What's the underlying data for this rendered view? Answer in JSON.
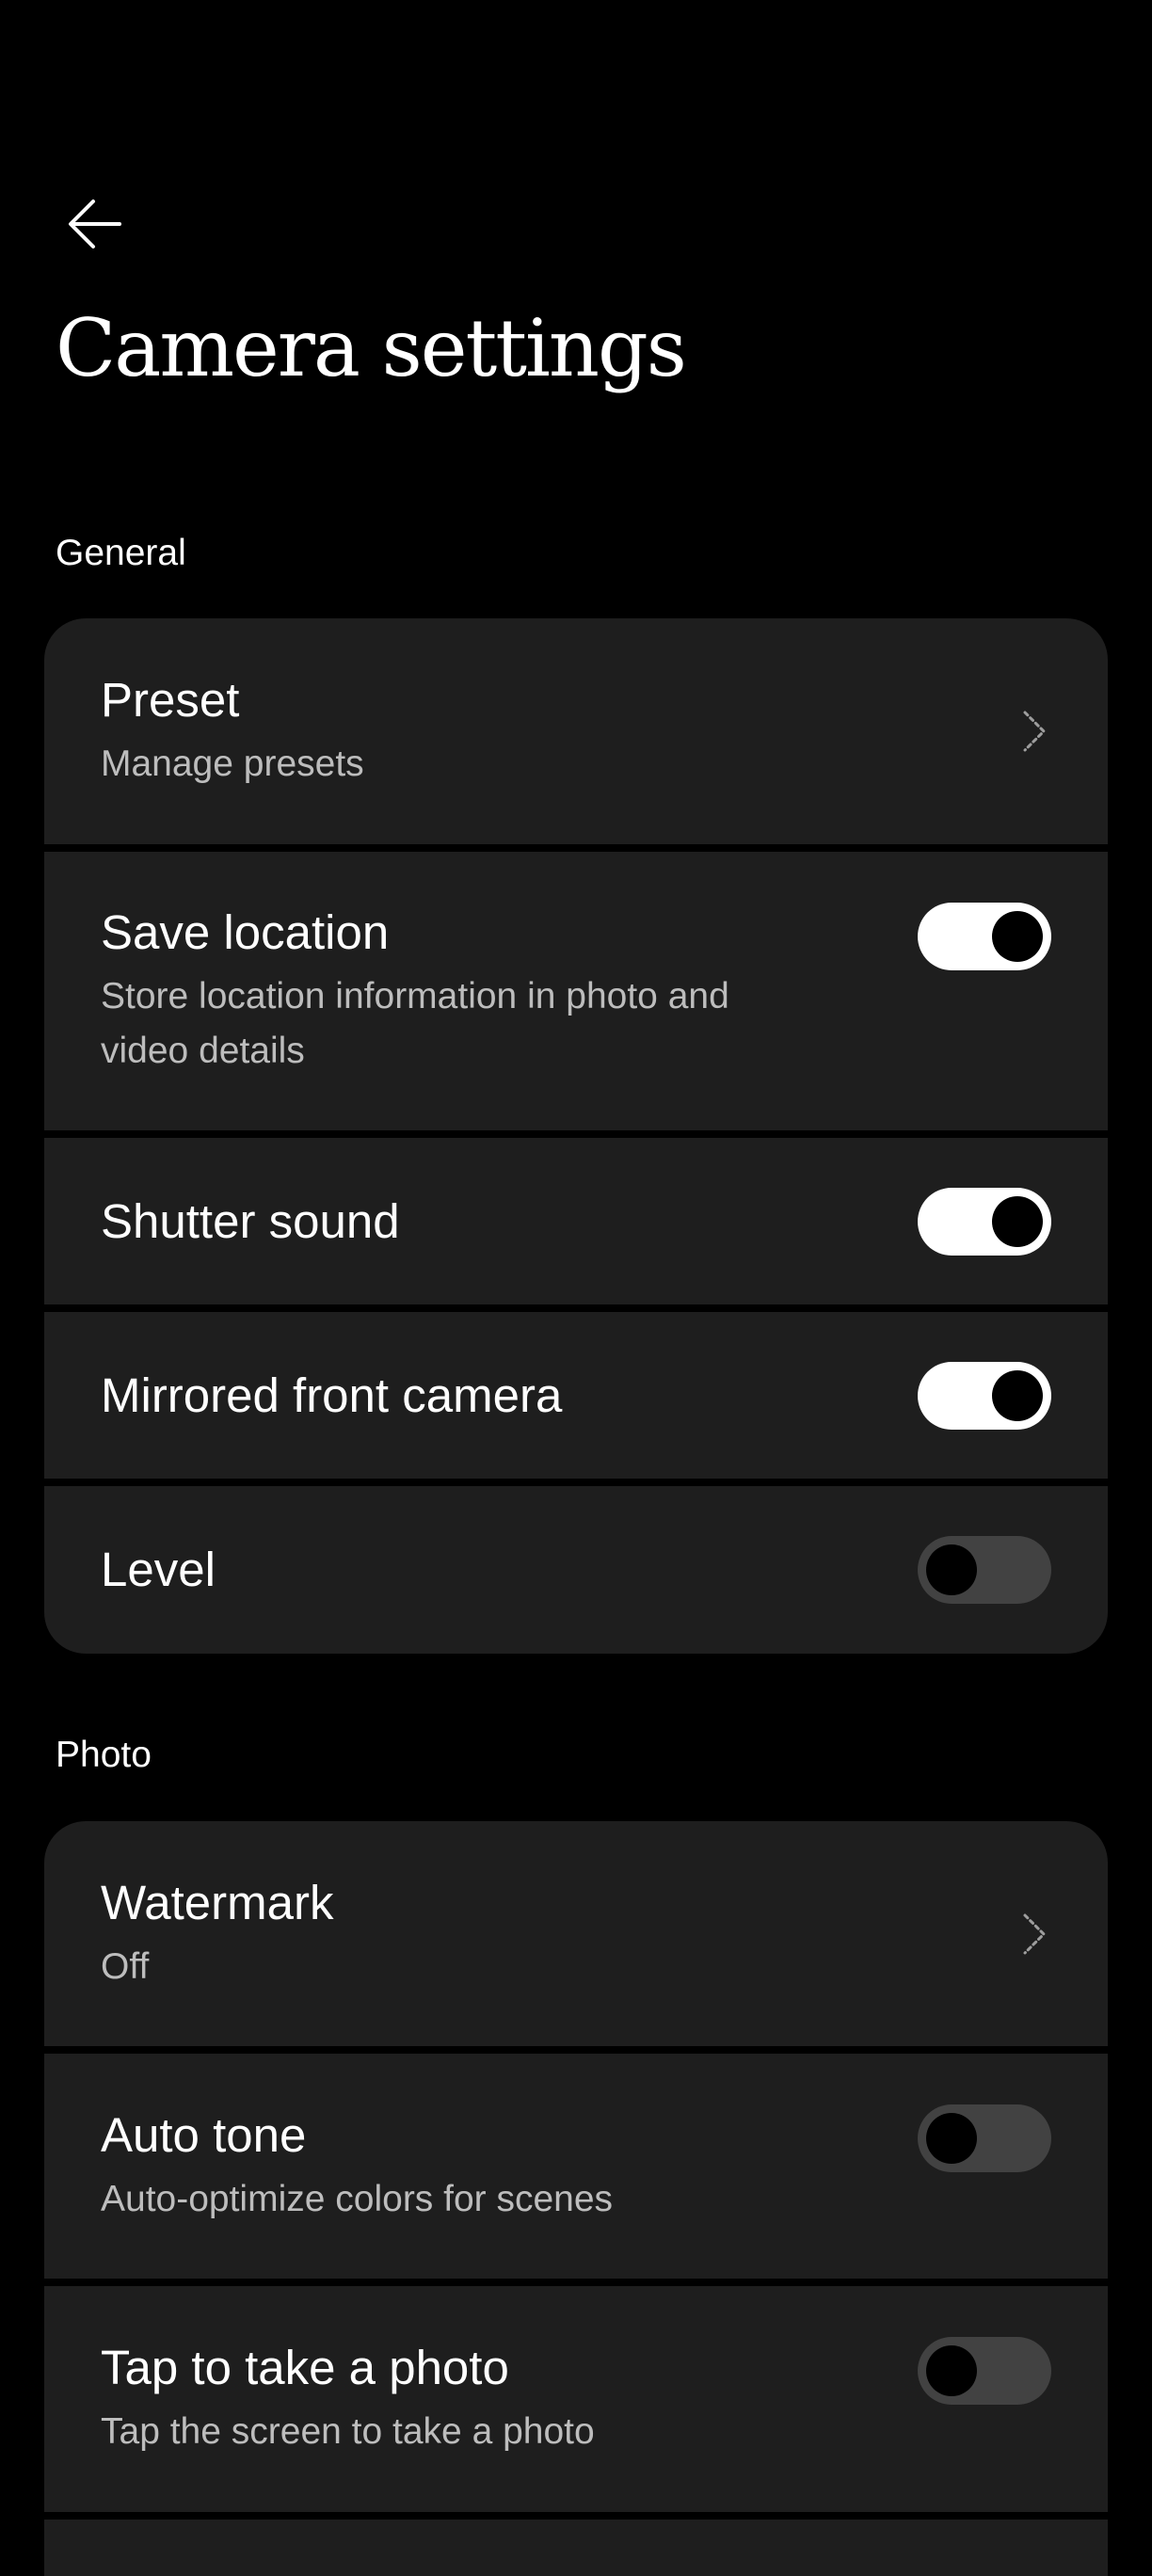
{
  "header": {
    "title": "Camera settings"
  },
  "sections": {
    "general": {
      "label": "General",
      "preset": {
        "title": "Preset",
        "subtitle": "Manage presets"
      },
      "save_location": {
        "title": "Save location",
        "subtitle": "Store location information in photo and video details",
        "enabled": true
      },
      "shutter_sound": {
        "title": "Shutter sound",
        "enabled": true
      },
      "mirrored_front_camera": {
        "title": "Mirrored front camera",
        "enabled": true
      },
      "level": {
        "title": "Level",
        "enabled": false
      }
    },
    "photo": {
      "label": "Photo",
      "watermark": {
        "title": "Watermark",
        "subtitle": "Off"
      },
      "auto_tone": {
        "title": "Auto tone",
        "subtitle": "Auto-optimize colors for scenes",
        "enabled": false
      },
      "tap_to_take_photo": {
        "title": "Tap to take a photo",
        "subtitle": "Tap the screen to take a photo",
        "enabled": false
      }
    }
  },
  "icons": {
    "back": "back-arrow-icon",
    "chevron": "chevron-right-icon"
  },
  "colors": {
    "background": "#000000",
    "card": "#1e1e1e",
    "toggle_on": "#ffffff",
    "toggle_off": "#424242",
    "subtitle": "#bdbdbd"
  }
}
